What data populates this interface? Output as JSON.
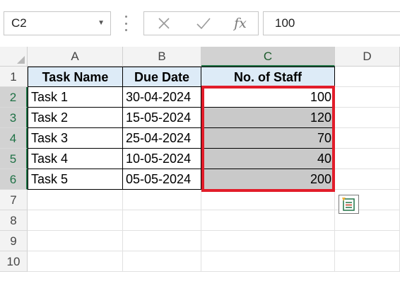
{
  "formula_bar": {
    "name_box": "C2",
    "name_box_dropdown_icon": "chevron-down-icon",
    "cancel_icon": "close-icon",
    "enter_icon": "checkmark-icon",
    "function_label": "fx",
    "formula_value": "100"
  },
  "columns": [
    "A",
    "B",
    "C",
    "D"
  ],
  "rows": [
    "1",
    "2",
    "3",
    "4",
    "5",
    "6",
    "7",
    "8",
    "9",
    "10"
  ],
  "table": {
    "headers": [
      "Task Name",
      "Due Date",
      "No. of Staff"
    ],
    "rows": [
      [
        "Task 1",
        "30-04-2024",
        "100"
      ],
      [
        "Task 2",
        "15-05-2024",
        "120"
      ],
      [
        "Task 3",
        "25-04-2024",
        "70"
      ],
      [
        "Task 4",
        "10-05-2024",
        "40"
      ],
      [
        "Task 5",
        "05-05-2024",
        "200"
      ]
    ]
  },
  "selection": {
    "range_start": "C2",
    "range_end": "C6",
    "highlight_color": "#e21d2a"
  },
  "quick_analysis_icon": "quick-analysis-icon",
  "colors": {
    "header_fill": "#ddebf7",
    "shaded_fill": "#c9c9c9",
    "excel_green": "#217346"
  }
}
